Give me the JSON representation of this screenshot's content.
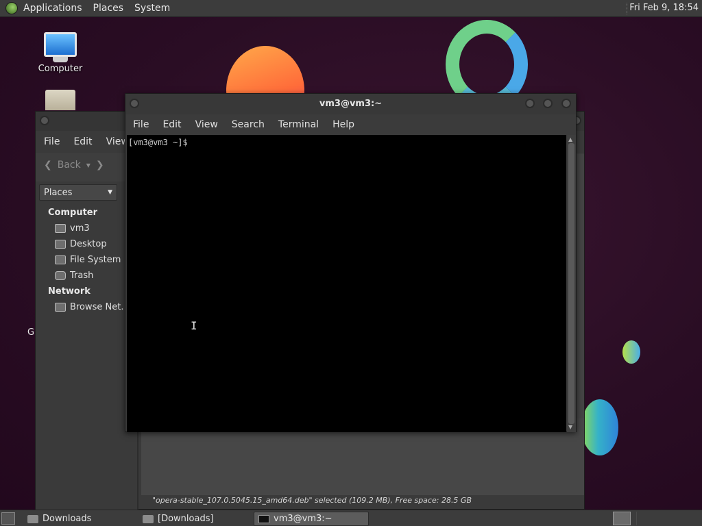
{
  "top_panel": {
    "menus": [
      "Applications",
      "Places",
      "System"
    ],
    "clock": "Fri Feb  9, 18:54"
  },
  "desktop": {
    "icons": [
      {
        "label": "Computer",
        "icon": "computer-icon"
      },
      {
        "label": "",
        "icon": "home-folder-icon"
      }
    ],
    "stray_text": "G"
  },
  "file_manager": {
    "menus": [
      "File",
      "Edit",
      "View"
    ],
    "back_label": "Back",
    "places_label": "Places",
    "sidebar": {
      "computer_heading": "Computer",
      "computer_items": [
        {
          "label": "vm3",
          "icon": "home-icon"
        },
        {
          "label": "Desktop",
          "icon": "desktop-icon"
        },
        {
          "label": "File System",
          "icon": "drive-icon"
        },
        {
          "label": "Trash",
          "icon": "trash-icon"
        }
      ],
      "network_heading": "Network",
      "network_items": [
        {
          "label": "Browse Net…",
          "icon": "network-icon"
        }
      ]
    },
    "status": "\"opera-stable_107.0.5045.15_amd64.deb\" selected (109.2 MB), Free space: 28.5 GB"
  },
  "terminal": {
    "title": "vm3@vm3:~",
    "menus": [
      "File",
      "Edit",
      "View",
      "Search",
      "Terminal",
      "Help"
    ],
    "prompt": "[vm3@vm3 ~]$"
  },
  "bottom_panel": {
    "tasks": [
      {
        "label": "Downloads",
        "icon": "folder-icon",
        "active": false
      },
      {
        "label": "[Downloads]",
        "icon": "folder-icon",
        "active": false
      },
      {
        "label": "vm3@vm3:~",
        "icon": "terminal-icon",
        "active": true
      }
    ]
  }
}
